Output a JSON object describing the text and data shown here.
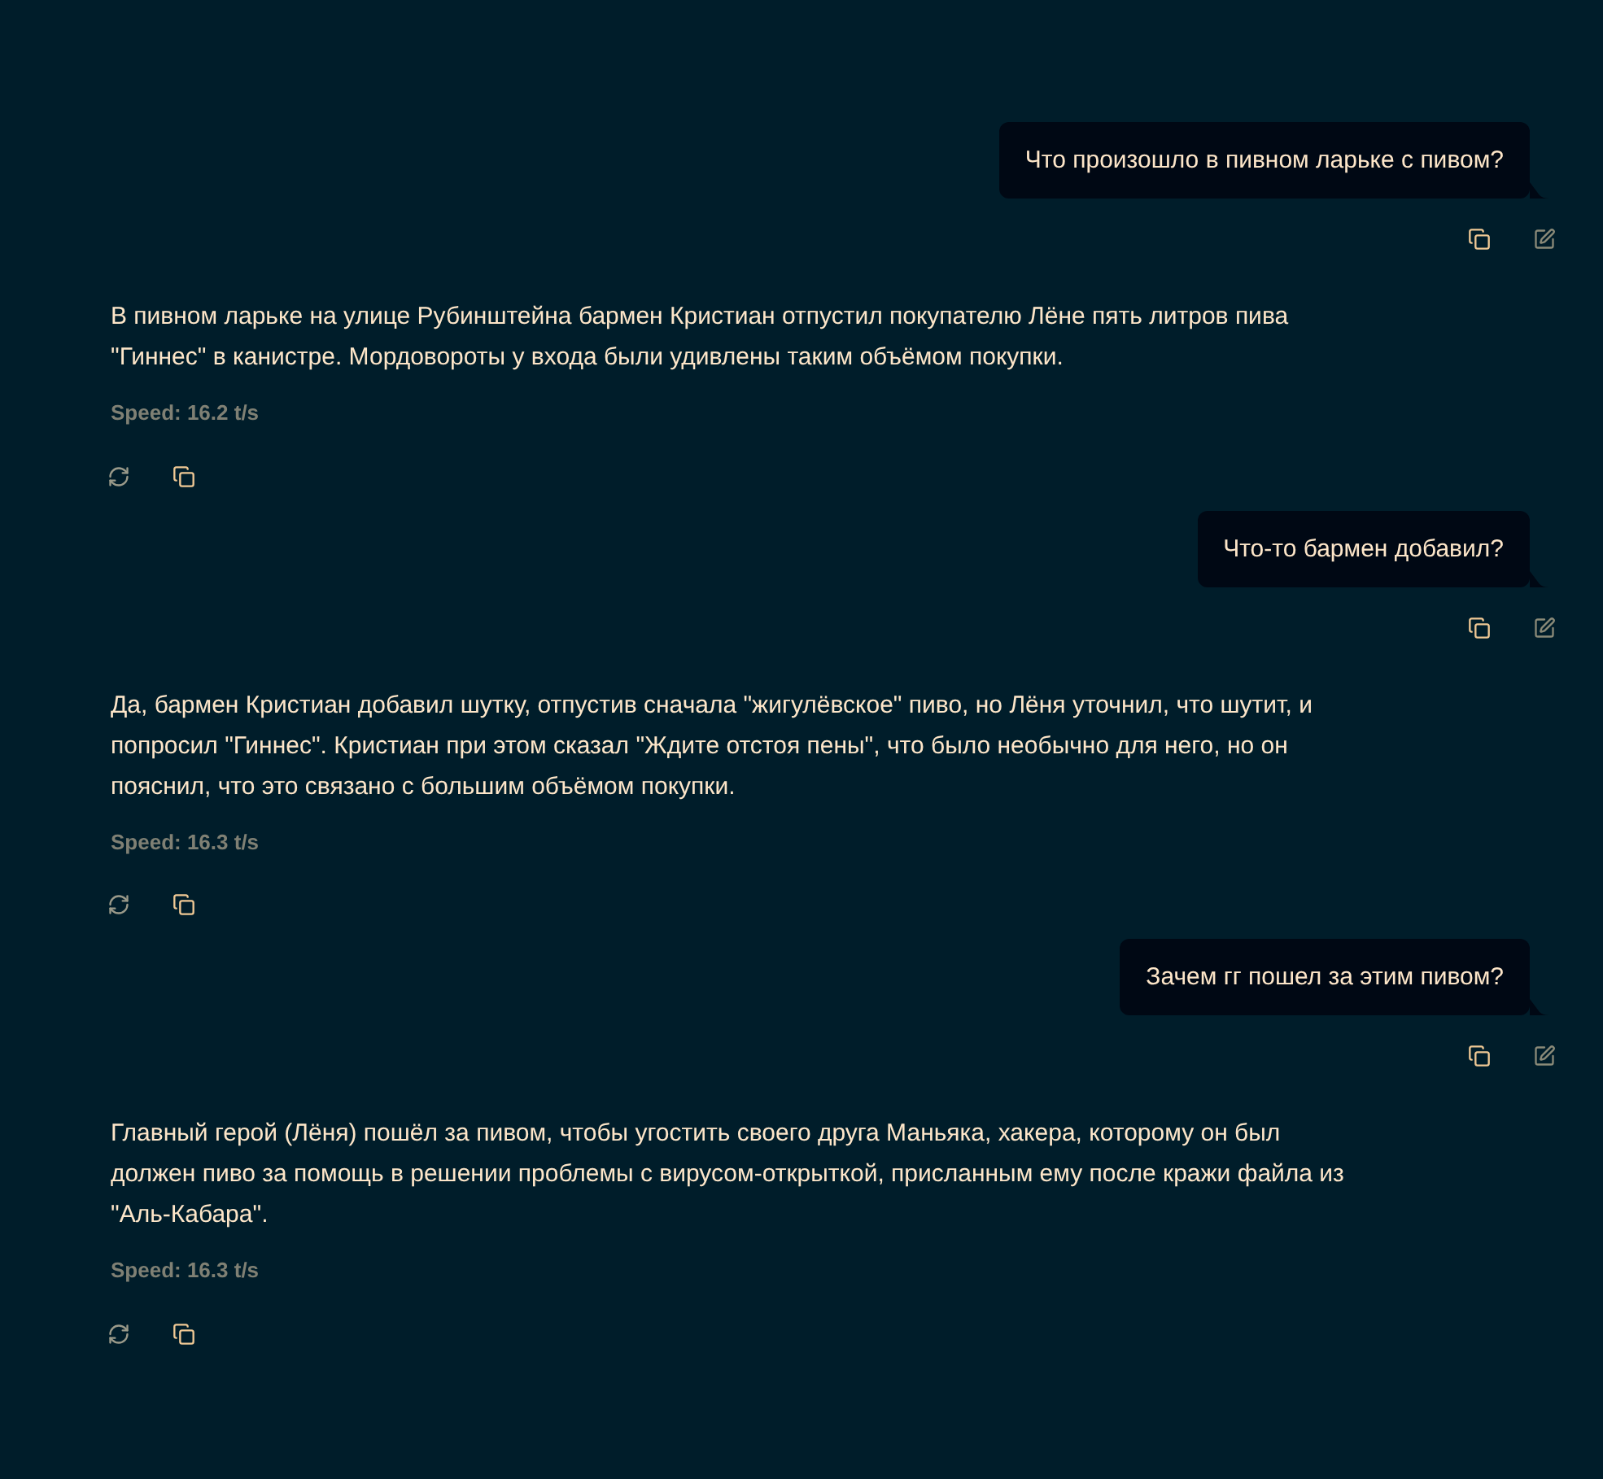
{
  "messages": [
    {
      "kind": "user",
      "text": "Что произошло в пивном ларьке с пивом?"
    },
    {
      "kind": "assistant",
      "text": "В пивном ларьке на улице Рубинштейна бармен Кристиан отпустил покупателю Лёне пять литров пива \"Гиннес\" в канистре. Мордовороты у входа были удивлены таким объёмом покупки.",
      "speed": "Speed: 16.2 t/s"
    },
    {
      "kind": "user",
      "text": "Что-то бармен добавил?"
    },
    {
      "kind": "assistant",
      "text": "Да, бармен Кристиан добавил шутку, отпустив сначала \"жигулёвское\" пиво, но Лёня уточнил, что шутит, и попросил \"Гиннес\". Кристиан при этом сказал \"Ждите отстоя пены\", что было необычно для него, но он пояснил, что это связано с большим объёмом покупки.",
      "speed": "Speed: 16.3 t/s"
    },
    {
      "kind": "user",
      "text": "Зачем гг пошел за этим пивом?"
    },
    {
      "kind": "assistant",
      "text": "Главный герой (Лёня) пошёл за пивом, чтобы угостить своего друга Маньяка, хакера, которому он был должен пиво за помощь в решении проблемы с вирусом-открыткой, присланным ему после кражи файла из \"Аль-Кабара\".",
      "speed": "Speed: 16.3 t/s"
    }
  ]
}
